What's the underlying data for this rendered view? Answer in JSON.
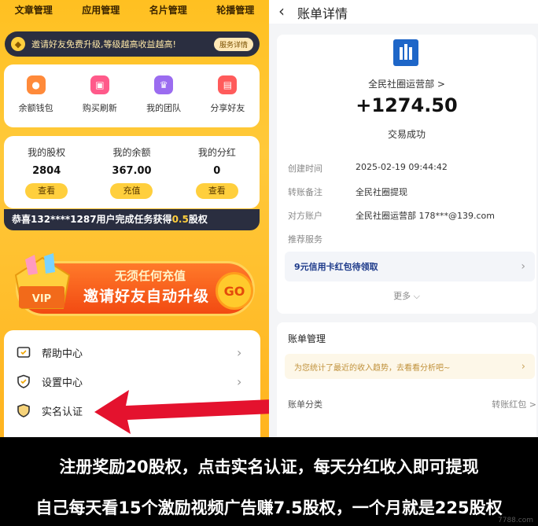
{
  "left": {
    "topnav": [
      "文章管理",
      "应用管理",
      "名片管理",
      "轮播管理"
    ],
    "invite_bar": {
      "text": "邀请好友免费升级,等级越高收益越高!",
      "button": "服务详情"
    },
    "quick": [
      {
        "label": "余额钱包",
        "color": "#ff8a3a",
        "icon": "wallet-icon"
      },
      {
        "label": "购买刷新",
        "color": "#ff5a8a",
        "icon": "gift-icon"
      },
      {
        "label": "我的团队",
        "color": "#9b6cf0",
        "icon": "crown-icon"
      },
      {
        "label": "分享好友",
        "color": "#ff5b5b",
        "icon": "share-icon"
      }
    ],
    "stats": [
      {
        "label": "我的股权",
        "value": "2804",
        "button": "查看"
      },
      {
        "label": "我的余额",
        "value": "367.00",
        "button": "充值"
      },
      {
        "label": "我的分红",
        "value": "0",
        "button": "查看"
      }
    ],
    "ticker": {
      "pre": "恭喜132****1287用户完成任务获得",
      "hl": "0.5",
      "post": "股权"
    },
    "banner": {
      "line1": "无须任何充值",
      "line2": "邀请好友自动升级",
      "go": "GO",
      "vip": "VIP"
    },
    "menu": [
      "帮助中心",
      "设置中心",
      "实名认证"
    ]
  },
  "right": {
    "header": {
      "title": "账单详情"
    },
    "merchant": "全民社圈运营部 >",
    "amount": "+1274.50",
    "status": "交易成功",
    "rows": [
      {
        "k": "创建时间",
        "v": "2025-02-19 09:44:42"
      },
      {
        "k": "转账备注",
        "v": "全民社圈提现"
      },
      {
        "k": "对方账户",
        "v": "全民社圈运营部 178***@139.com"
      },
      {
        "k": "推荐服务",
        "v": ""
      }
    ],
    "service": "9元信用卡红包待领取",
    "more": "更多 ⌵",
    "manage_title": "账单管理",
    "tip": "为您统计了最近的收入趋势，去看看分析吧~",
    "category": {
      "k": "账单分类",
      "v": "转账红包 >"
    }
  },
  "caption": {
    "line1": "注册奖励20股权，点击实名认证，每天分红收入即可提现",
    "line2": "自己每天看15个激励视频广告赚7.5股权，一个月就是225股权",
    "watermark": "7788.com"
  }
}
